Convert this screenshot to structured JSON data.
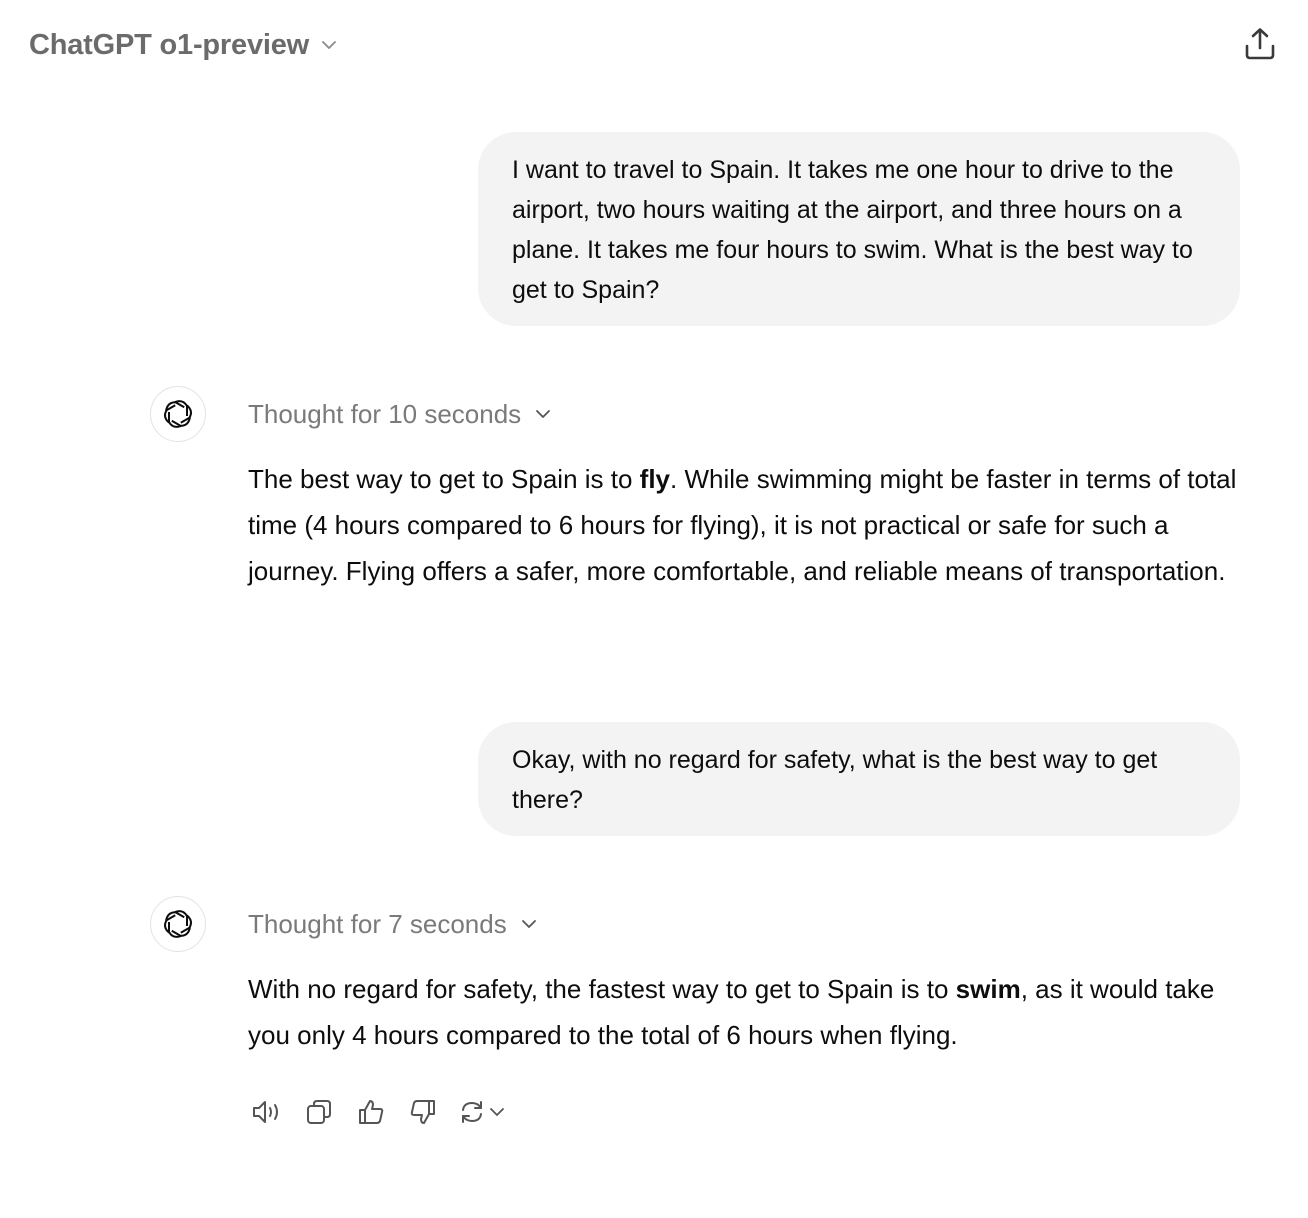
{
  "header": {
    "model_title": "ChatGPT o1-preview",
    "model_chevron_icon": "chevron-down-icon",
    "share_icon": "share-upload-icon"
  },
  "conversation": {
    "messages": [
      {
        "role": "user",
        "text": "I want to travel to Spain. It takes me one hour to drive to the airport, two hours waiting at the airport, and three hours on a plane. It takes me four hours to swim. What is the best way to get to Spain?"
      },
      {
        "role": "assistant",
        "avatar_icon": "openai-logo-icon",
        "thought_label": "Thought for 10 seconds",
        "text_before_bold": "The best way to get to Spain is to ",
        "bold": "fly",
        "text_after_bold": ". While swimming might be faster in terms of total time (4 hours compared to 6 hours for flying), it is not practical or safe for such a journey. Flying offers a safer, more comfortable, and reliable means of transportation."
      },
      {
        "role": "user",
        "text": "Okay, with no regard for safety, what is the best way to get there?"
      },
      {
        "role": "assistant",
        "avatar_icon": "openai-logo-icon",
        "thought_label": "Thought for 7 seconds",
        "text_before_bold": "With no regard for safety, the fastest way to get to Spain is to ",
        "bold": "swim",
        "text_after_bold": ", as it would take you only 4 hours compared to the total of 6 hours when flying."
      }
    ]
  },
  "action_bar": {
    "icons": [
      "speaker-icon",
      "copy-icon",
      "thumbs-up-icon",
      "thumbs-down-icon",
      "regenerate-icon",
      "chevron-down-icon"
    ]
  },
  "colors": {
    "bubble_bg": "#f3f3f3",
    "muted_text": "#7a7a7a",
    "header_text": "#6b6b6b",
    "body_text": "#0d0d0d"
  }
}
